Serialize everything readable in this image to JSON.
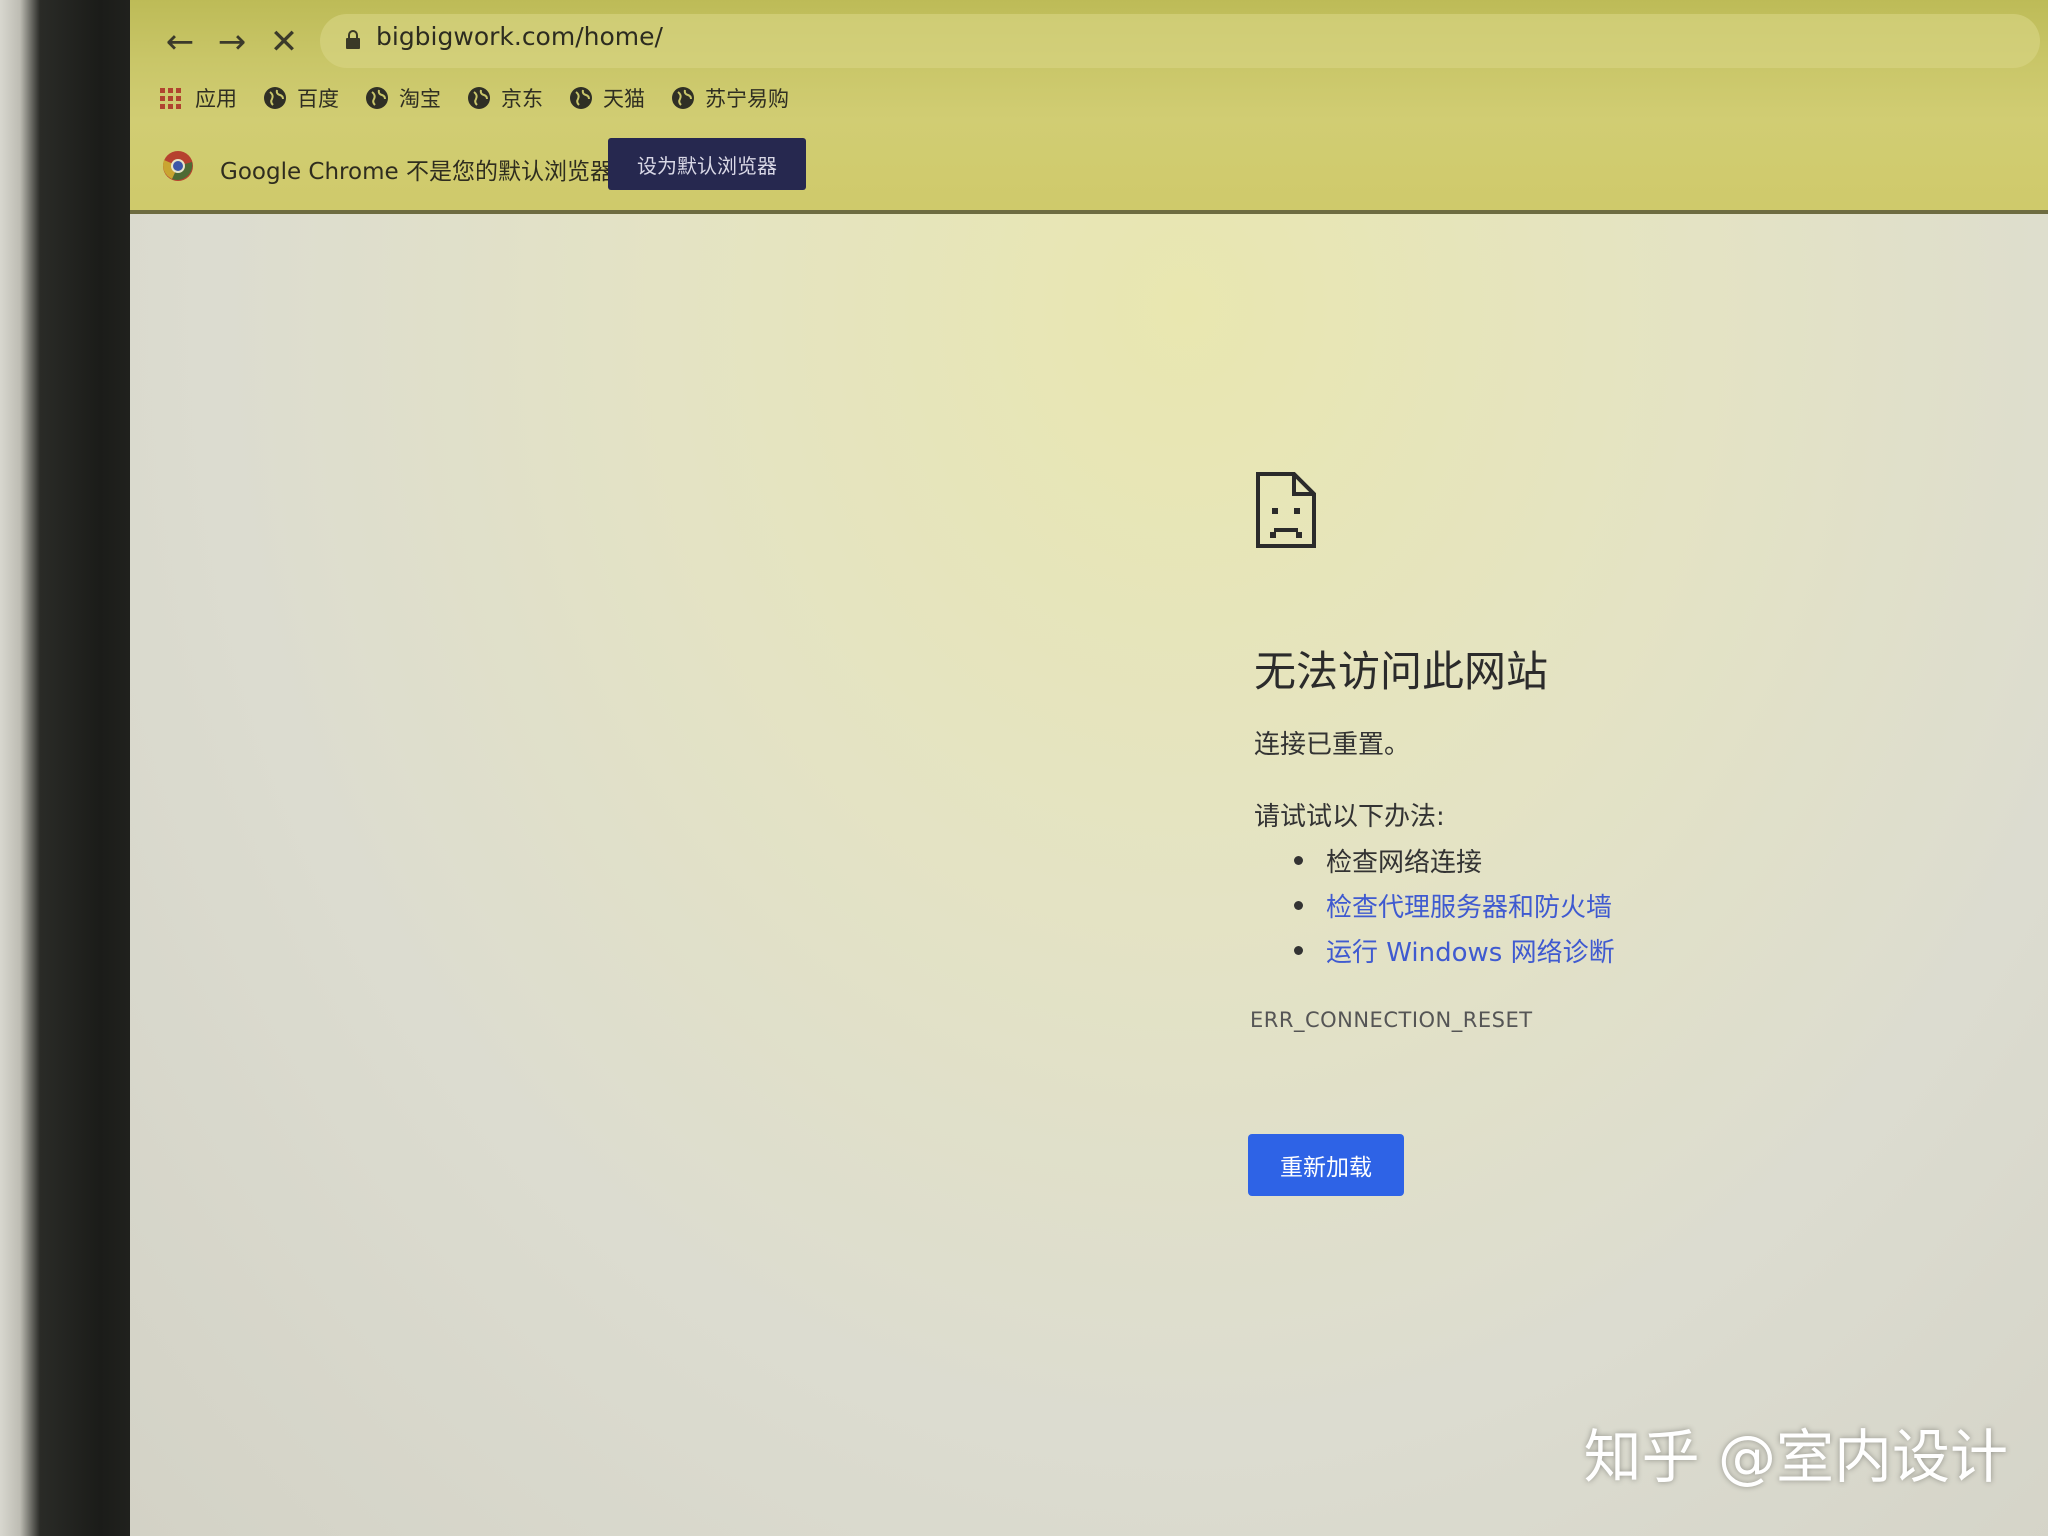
{
  "browser": {
    "url": "bigbigwork.com/home/",
    "bookmarks": [
      "应用",
      "百度",
      "淘宝",
      "京东",
      "天猫",
      "苏宁易购"
    ],
    "infobar": {
      "message": "Google Chrome 不是您的默认浏览器",
      "button_label": "设为默认浏览器"
    }
  },
  "error_page": {
    "title": "无法访问此网站",
    "subtitle": "连接已重置。",
    "try_label": "请试试以下办法:",
    "suggestions": {
      "check_network": "检查网络连接",
      "check_proxy": "检查代理服务器和防火墙",
      "run_diagnostics": "运行 Windows 网络诊断"
    },
    "error_code": "ERR_CONNECTION_RESET",
    "reload_label": "重新加载"
  },
  "watermark": "知乎 @室内设计",
  "colors": {
    "link": "#3f5ad0",
    "reload_button": "#2e63e6",
    "infobar_button": "#26284f"
  },
  "icons": {
    "back": "arrow-left-icon",
    "forward": "arrow-right-icon",
    "stop": "close-icon",
    "lock": "lock-icon",
    "apps": "apps-grid-icon",
    "bookmark": "globe-icon",
    "chrome": "chrome-logo-icon",
    "error": "sad-document-icon"
  }
}
